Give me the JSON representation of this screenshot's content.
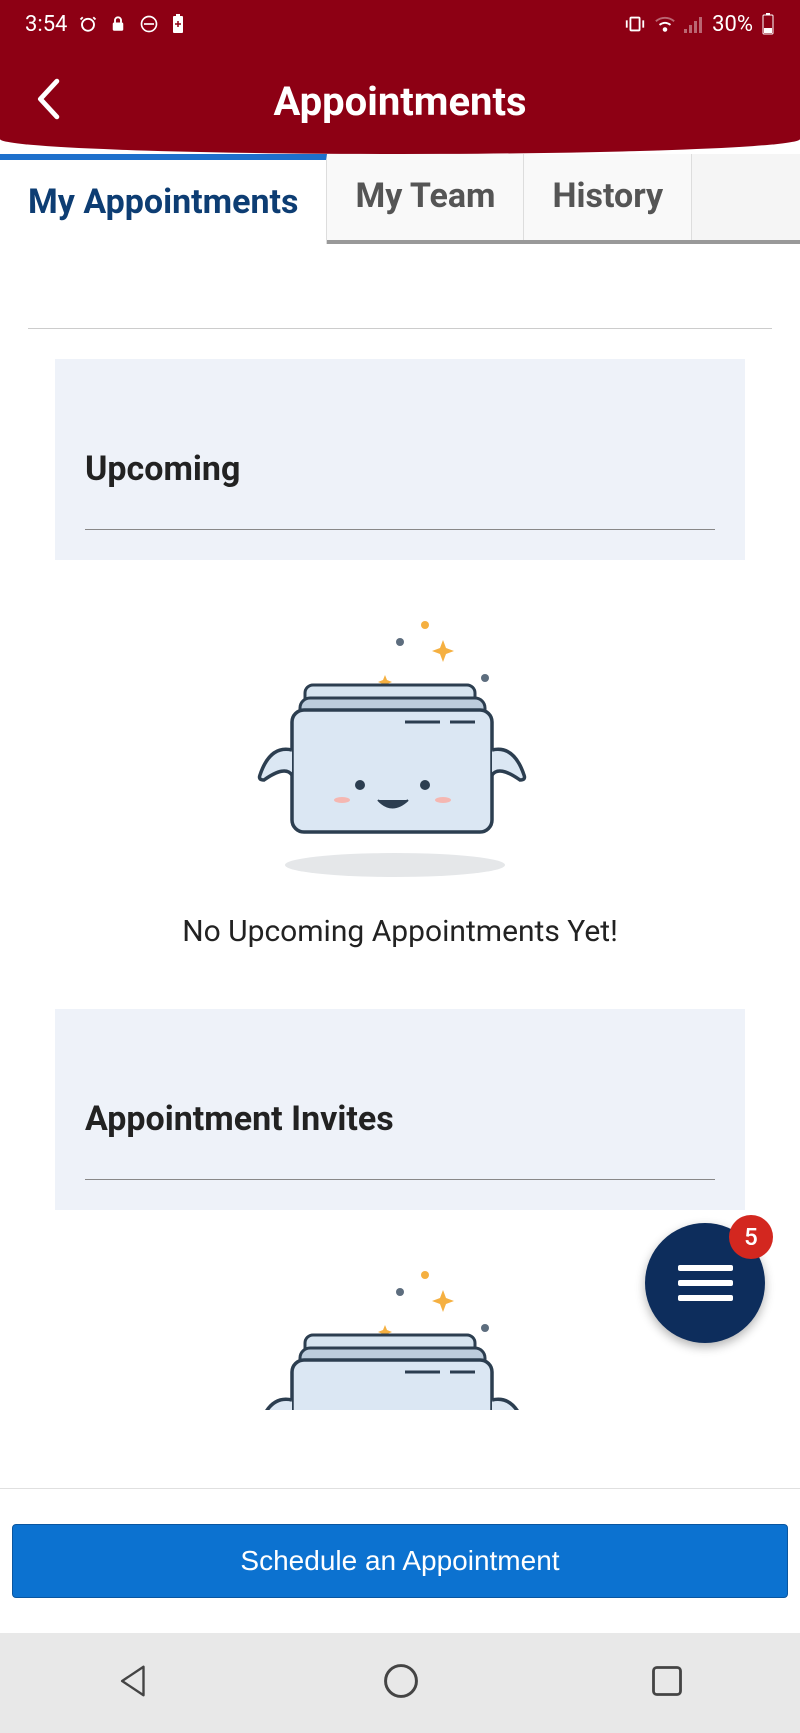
{
  "status": {
    "time": "3:54",
    "battery": "30%"
  },
  "header": {
    "title": "Appointments"
  },
  "tabs": {
    "my": "My Appointments",
    "team": "My Team",
    "history": "History"
  },
  "sections": {
    "upcoming": {
      "title": "Upcoming",
      "emptyMessage": "No Upcoming Appointments Yet!"
    },
    "invites": {
      "title": "Appointment Invites"
    }
  },
  "fab": {
    "badge": "5"
  },
  "actions": {
    "schedule": "Schedule an Appointment"
  }
}
